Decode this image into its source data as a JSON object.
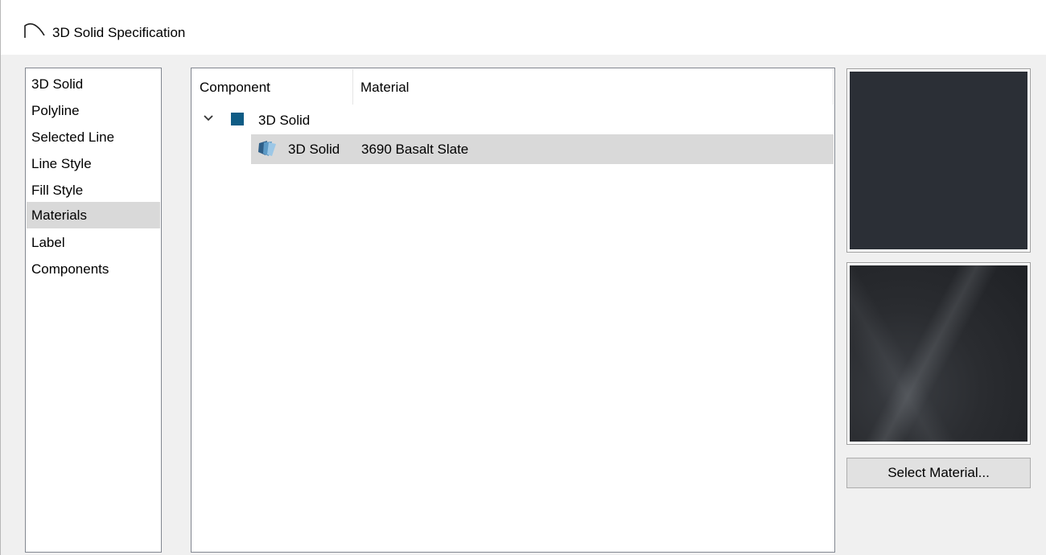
{
  "window": {
    "title": "3D Solid Specification"
  },
  "nav": {
    "items": [
      {
        "label": "3D Solid"
      },
      {
        "label": "Polyline"
      },
      {
        "label": "Selected Line"
      },
      {
        "label": "Line Style"
      },
      {
        "label": "Fill Style"
      },
      {
        "label": "Materials",
        "selected": true
      },
      {
        "label": "Label"
      },
      {
        "label": "Components"
      }
    ]
  },
  "tree": {
    "columns": [
      "Component",
      "Material"
    ],
    "rows": [
      {
        "expand_icon": "chevron-down-icon",
        "swatch_color": "#0f5c85",
        "component": "3D Solid",
        "material": ""
      },
      {
        "icon": "material-icon",
        "component": "3D Solid",
        "material": "3690 Basalt Slate",
        "selected": true
      }
    ]
  },
  "preview": {
    "color": "#2b2f36",
    "texture_name": "3690 Basalt Slate"
  },
  "buttons": {
    "select_material": "Select Material..."
  }
}
